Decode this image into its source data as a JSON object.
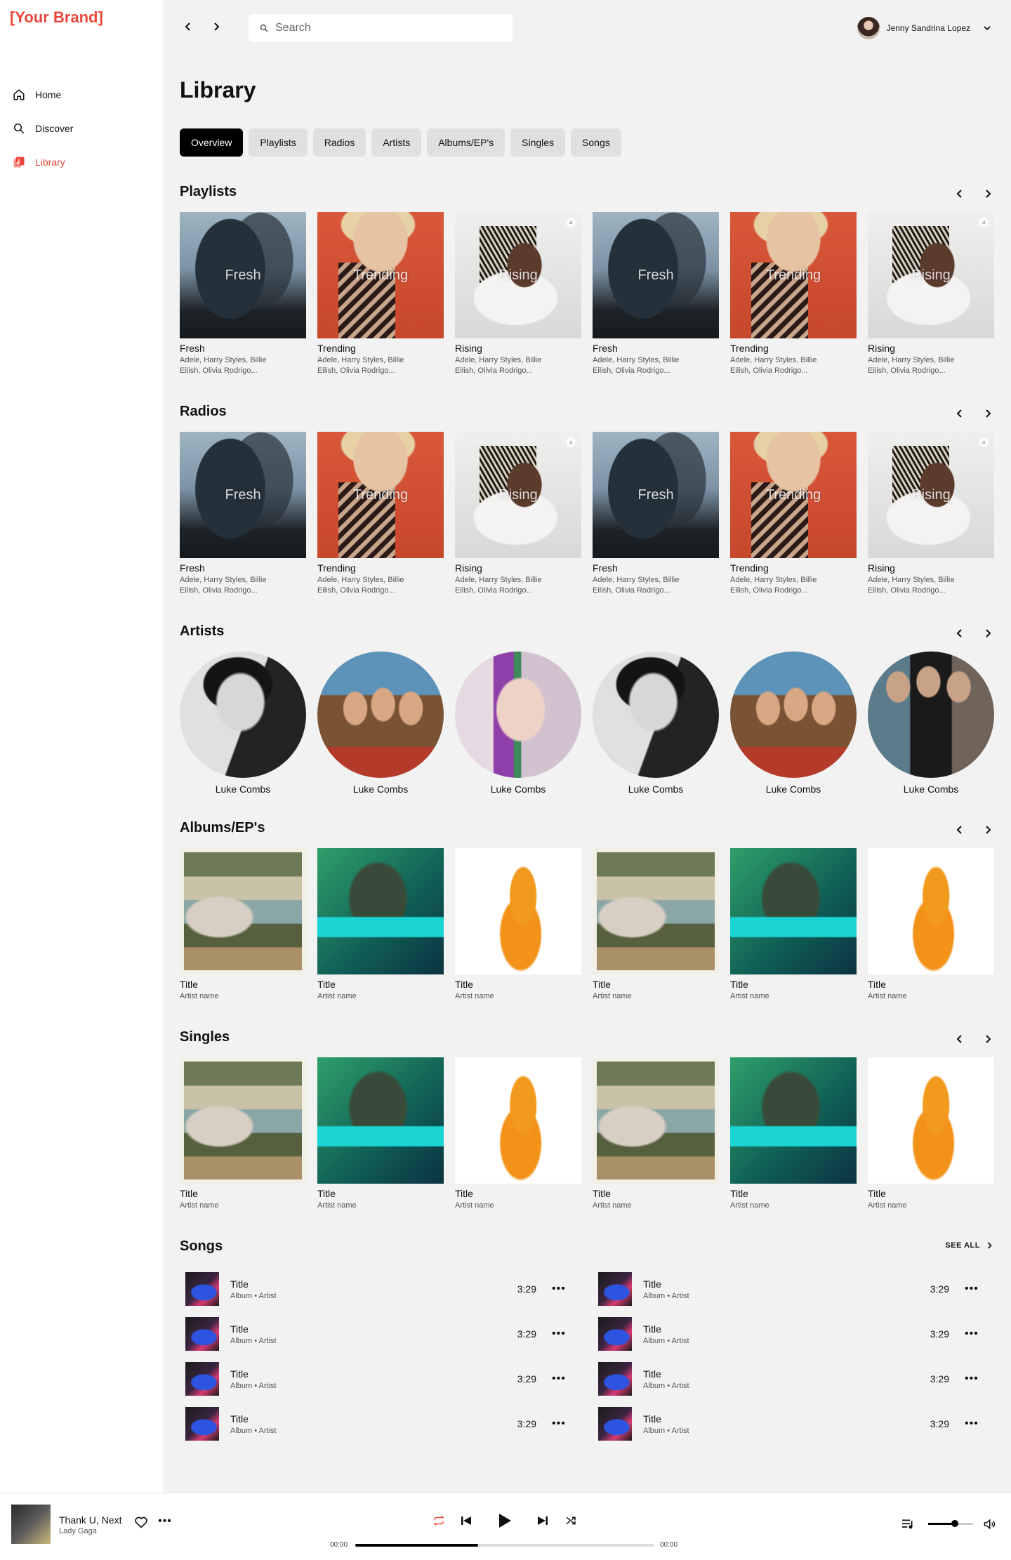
{
  "brand": "[Your Brand]",
  "nav": [
    {
      "label": "Home",
      "icon": "home-icon"
    },
    {
      "label": "Discover",
      "icon": "search-icon"
    },
    {
      "label": "Library",
      "icon": "library-icon",
      "active": true
    }
  ],
  "search": {
    "placeholder": "Search"
  },
  "user": {
    "name": "Jenny Sandrina Lopez"
  },
  "page": {
    "title": "Library"
  },
  "tabs": [
    "Overview",
    "Playlists",
    "Radios",
    "Artists",
    "Albums/EP's",
    "Singles",
    "Songs"
  ],
  "colors": {
    "accent": "#e8483b",
    "main_bg": "#f2f2f2"
  },
  "playlists": {
    "title": "Playlists",
    "items": [
      {
        "title": "Fresh",
        "overlay": "Fresh",
        "line1": "Adele, Harry Styles, Billie",
        "line2": "Eilish, Olivia Rodrigo..."
      },
      {
        "title": "Trending",
        "overlay": "Trending",
        "line1": "Adele, Harry Styles, Billie",
        "line2": "Eilish, Olivia Rodrigo..."
      },
      {
        "title": "Rising",
        "overlay": "Rising",
        "line1": "Adele, Harry Styles, Billie",
        "line2": "Eilish, Olivia Rodrigo..."
      },
      {
        "title": "Fresh",
        "overlay": "Fresh",
        "line1": "Adele, Harry Styles, Billie",
        "line2": "Eilish, Olivia Rodrigo..."
      },
      {
        "title": "Trending",
        "overlay": "Trending",
        "line1": "Adele, Harry Styles, Billie",
        "line2": "Eilish, Olivia Rodrigo..."
      },
      {
        "title": "Rising",
        "overlay": "Rising",
        "line1": "Adele, Harry Styles, Billie",
        "line2": "Eilish, Olivia Rodrigo..."
      }
    ]
  },
  "radios": {
    "title": "Radios",
    "items": [
      {
        "title": "Fresh",
        "overlay": "Fresh",
        "line1": "Adele, Harry Styles, Billie",
        "line2": "Eilish, Olivia Rodrigo..."
      },
      {
        "title": "Trending",
        "overlay": "Trending",
        "line1": "Adele, Harry Styles, Billie",
        "line2": "Eilish, Olivia Rodrigo..."
      },
      {
        "title": "Rising",
        "overlay": "Rising",
        "line1": "Adele, Harry Styles, Billie",
        "line2": "Eilish, Olivia Rodrigo..."
      },
      {
        "title": "Fresh",
        "overlay": "Fresh",
        "line1": "Adele, Harry Styles, Billie",
        "line2": "Eilish, Olivia Rodrigo..."
      },
      {
        "title": "Trending",
        "overlay": "Trending",
        "line1": "Adele, Harry Styles, Billie",
        "line2": "Eilish, Olivia Rodrigo..."
      },
      {
        "title": "Rising",
        "overlay": "Rising",
        "line1": "Adele, Harry Styles, Billie",
        "line2": "Eilish, Olivia Rodrigo..."
      }
    ]
  },
  "artists": {
    "title": "Artists",
    "items": [
      {
        "name": "Luke Combs"
      },
      {
        "name": "Luke Combs"
      },
      {
        "name": "Luke Combs"
      },
      {
        "name": "Luke Combs"
      },
      {
        "name": "Luke Combs"
      },
      {
        "name": "Luke Combs"
      }
    ]
  },
  "albums": {
    "title": "Albums/EP's",
    "items": [
      {
        "title": "Title",
        "artist": "Artist name"
      },
      {
        "title": "Title",
        "artist": "Artist name"
      },
      {
        "title": "Title",
        "artist": "Artist name"
      },
      {
        "title": "Title",
        "artist": "Artist name"
      },
      {
        "title": "Title",
        "artist": "Artist name"
      },
      {
        "title": "Title",
        "artist": "Artist name"
      }
    ]
  },
  "singles": {
    "title": "Singles",
    "items": [
      {
        "title": "Title",
        "artist": "Artist name"
      },
      {
        "title": "Title",
        "artist": "Artist name"
      },
      {
        "title": "Title",
        "artist": "Artist name"
      },
      {
        "title": "Title",
        "artist": "Artist name"
      },
      {
        "title": "Title",
        "artist": "Artist name"
      },
      {
        "title": "Title",
        "artist": "Artist name"
      }
    ]
  },
  "songs": {
    "title": "Songs",
    "see_all": "SEE ALL",
    "items": [
      {
        "title": "Title",
        "sub": "Album • Artist",
        "duration": "3:29"
      },
      {
        "title": "Title",
        "sub": "Album • Artist",
        "duration": "3:29"
      },
      {
        "title": "Title",
        "sub": "Album • Artist",
        "duration": "3:29"
      },
      {
        "title": "Title",
        "sub": "Album • Artist",
        "duration": "3:29"
      },
      {
        "title": "Title",
        "sub": "Album • Artist",
        "duration": "3:29"
      },
      {
        "title": "Title",
        "sub": "Album • Artist",
        "duration": "3:29"
      },
      {
        "title": "Title",
        "sub": "Album • Artist",
        "duration": "3:29"
      },
      {
        "title": "Title",
        "sub": "Album • Artist",
        "duration": "3:29"
      }
    ]
  },
  "player": {
    "title": "Thank U, Next",
    "artist": "Lady Gaga",
    "time_current": "00:00",
    "time_total": "00:00",
    "progress": 0.41,
    "volume": 0.6
  }
}
